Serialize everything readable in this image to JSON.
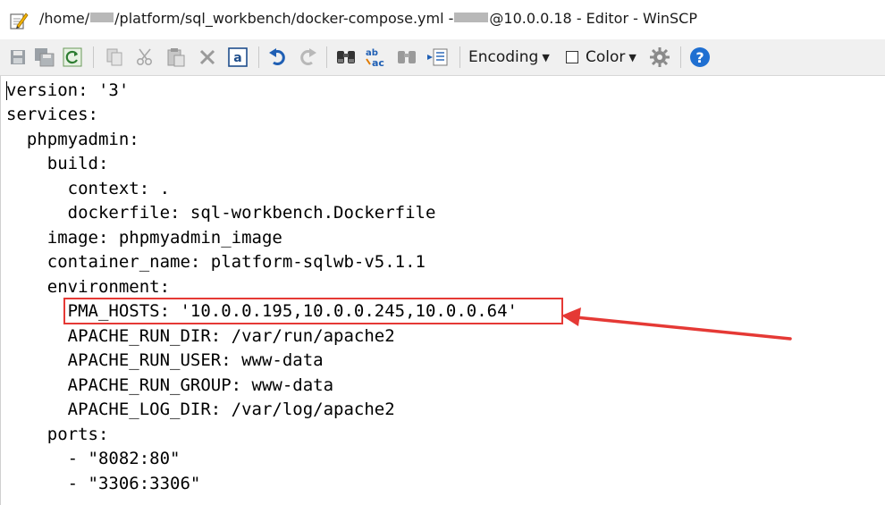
{
  "window": {
    "title_prefix": "/home/",
    "title_middle": "/platform/sql_workbench/docker-compose.yml - ",
    "title_suffix": "@10.0.0.18 - Editor - WinSCP"
  },
  "toolbar": {
    "encoding_label": "Encoding",
    "color_label": "Color",
    "color_checked": false,
    "icons": [
      "save-icon",
      "save-as-icon",
      "reload-icon",
      "copy-icon",
      "cut-icon",
      "paste-icon",
      "delete-icon",
      "select-all-icon",
      "undo-icon",
      "redo-icon",
      "find-icon",
      "replace-icon",
      "find-next-icon",
      "goto-line-icon",
      "encoding-dropdown",
      "color-checkbox",
      "settings-icon",
      "help-icon"
    ]
  },
  "editor": {
    "lines": [
      "version: '3'",
      "services:",
      "  phpmyadmin:",
      "    build:",
      "      context: .",
      "      dockerfile: sql-workbench.Dockerfile",
      "    image: phpmyadmin_image",
      "    container_name: platform-sqlwb-v5.1.1",
      "    environment:",
      "      PMA_HOSTS: '10.0.0.195,10.0.0.245,10.0.0.64'",
      "      APACHE_RUN_DIR: /var/run/apache2",
      "      APACHE_RUN_USER: www-data",
      "      APACHE_RUN_GROUP: www-data",
      "      APACHE_LOG_DIR: /var/log/apache2",
      "    ports:",
      "      - \"8082:80\"",
      "      - \"3306:3306\""
    ],
    "highlighted_line": 9
  },
  "annotation": {
    "color": "#e53935"
  }
}
